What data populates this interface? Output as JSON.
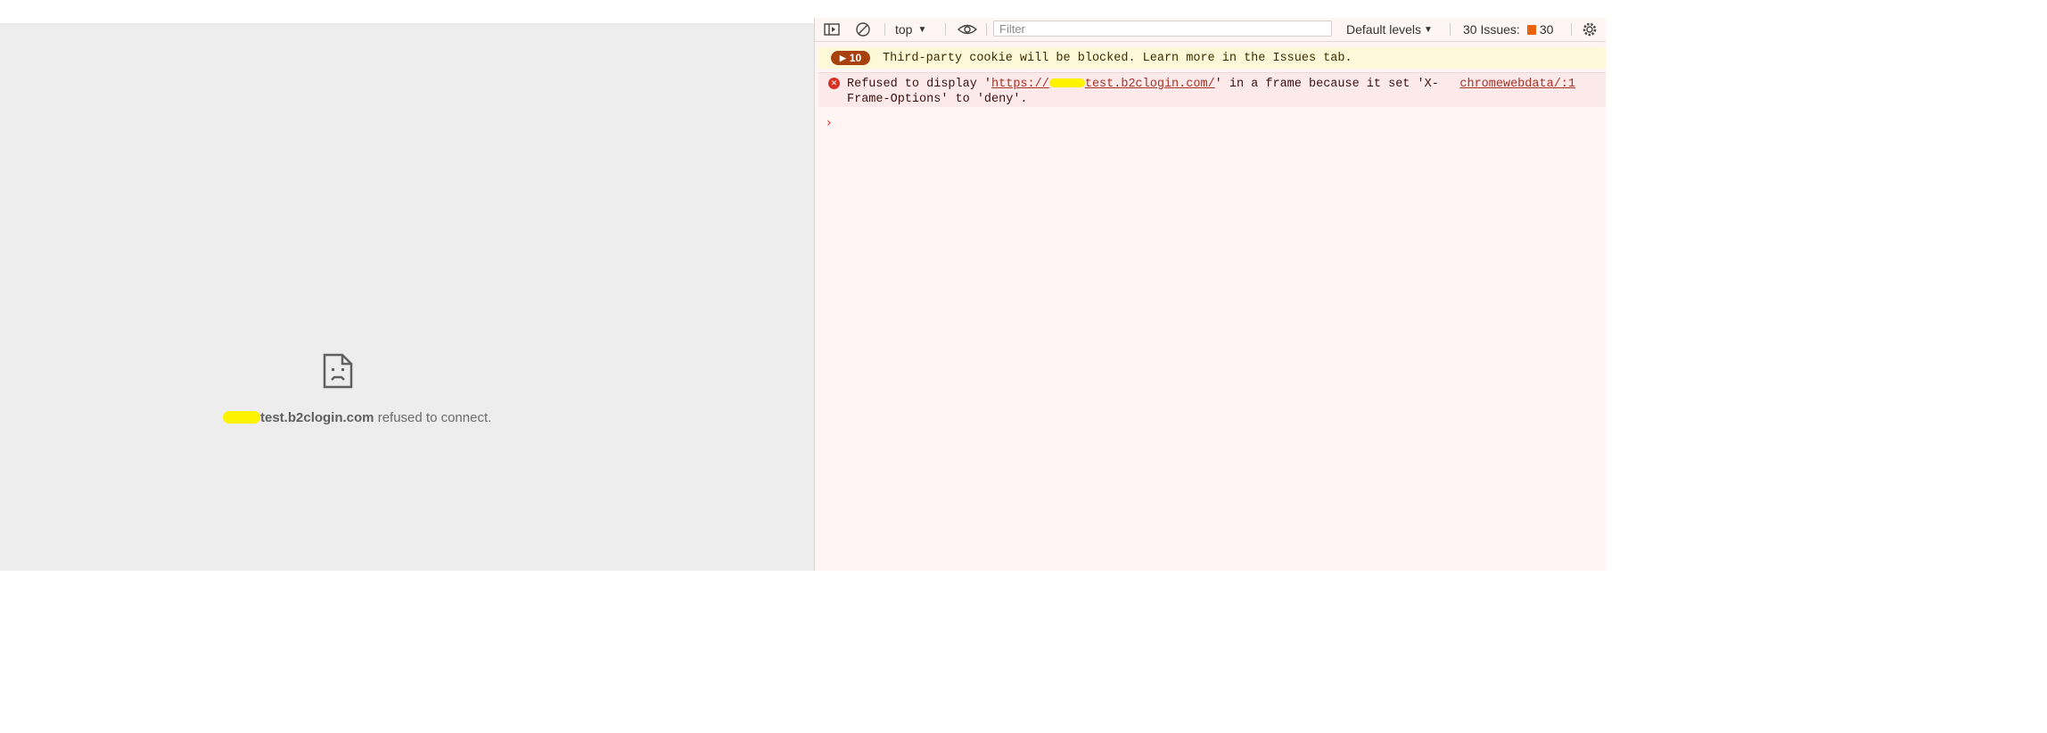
{
  "frame": {
    "host": "test.b2clogin.com",
    "message": " refused to connect."
  },
  "toolbar": {
    "context": "top",
    "filter_placeholder": "Filter",
    "levels": "Default levels",
    "issues_label": "30 Issues:",
    "issues_count": "30"
  },
  "console": {
    "warning": {
      "count": "10",
      "text": "Third-party cookie will be blocked. Learn more in the Issues tab."
    },
    "error": {
      "prefix": "Refused to display '",
      "url_start": "https://",
      "url_end": "test.b2clogin.com/",
      "middle": "' in a frame because it set 'X-",
      "line2": "Frame-Options' to 'deny'.",
      "source": "chromewebdata/:1"
    }
  },
  "icons": [
    "broken-document-icon",
    "toggle-sidebar-icon",
    "clear-console-icon",
    "live-expression-eye-icon",
    "issues-flag-icon",
    "settings-gear-icon",
    "error-x-icon",
    "prompt-chevron-icon",
    "expand-triangle-icon"
  ],
  "colors": {
    "frame_bg": "#ededed",
    "console_bg": "#fff5f5",
    "warning_bg": "#fdf9d8",
    "error_bg": "#fce9ea",
    "badge": "#a8410e",
    "error_red": "#d93025",
    "redaction": "#fff200"
  }
}
